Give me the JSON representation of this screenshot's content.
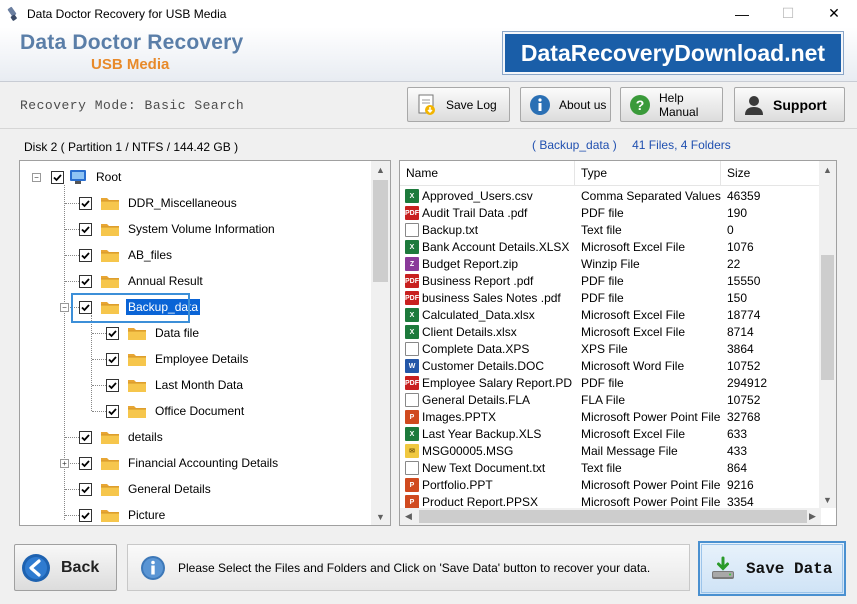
{
  "window": {
    "title": "Data Doctor Recovery for USB Media",
    "minimize": "—",
    "maximize": "☐",
    "close": "✕"
  },
  "header": {
    "brand_title": "Data Doctor Recovery",
    "brand_subtitle": "USB Media",
    "site_badge": "DataRecoveryDownload.net"
  },
  "toolbar": {
    "mode_label": "Recovery Mode: Basic Search",
    "save_log": "Save Log",
    "about_us": "About us",
    "help_manual": "Help Manual",
    "support": "Support"
  },
  "disk_label": "Disk 2 ( Partition 1 / NTFS / 144.42 GB )",
  "folder_info": {
    "folder": "( Backup_data )",
    "counts": "41 Files, 4 Folders"
  },
  "tree": {
    "root": "Root",
    "items": [
      {
        "label": "DDR_Miscellaneous",
        "level": 1,
        "checked": true,
        "expander": ""
      },
      {
        "label": "System Volume Information",
        "level": 1,
        "checked": true,
        "expander": ""
      },
      {
        "label": "AB_files",
        "level": 1,
        "checked": true,
        "expander": ""
      },
      {
        "label": "Annual Result",
        "level": 1,
        "checked": true,
        "expander": ""
      },
      {
        "label": "Backup_data",
        "level": 1,
        "checked": true,
        "expander": "−",
        "selected": true
      },
      {
        "label": "Data file",
        "level": 2,
        "checked": true,
        "expander": ""
      },
      {
        "label": "Employee Details",
        "level": 2,
        "checked": true,
        "expander": ""
      },
      {
        "label": "Last Month Data",
        "level": 2,
        "checked": true,
        "expander": ""
      },
      {
        "label": "Office Document",
        "level": 2,
        "checked": true,
        "expander": ""
      },
      {
        "label": "details",
        "level": 1,
        "checked": true,
        "expander": ""
      },
      {
        "label": "Financial Accounting Details",
        "level": 1,
        "checked": true,
        "expander": "+"
      },
      {
        "label": "General Details",
        "level": 1,
        "checked": true,
        "expander": ""
      },
      {
        "label": "Picture",
        "level": 1,
        "checked": true,
        "expander": ""
      }
    ]
  },
  "filelist": {
    "columns": [
      "Name",
      "Type",
      "Size"
    ],
    "rows": [
      {
        "name": "Approved_Users.csv",
        "type": "Comma Separated Values...",
        "size": "46359",
        "icon": "excel-icon"
      },
      {
        "name": "Audit Trail Data .pdf",
        "type": "PDF file",
        "size": "190",
        "icon": "pdf-icon"
      },
      {
        "name": "Backup.txt",
        "type": "Text file",
        "size": "0",
        "icon": "text-file-icon"
      },
      {
        "name": "Bank Account Details.XLSX",
        "type": "Microsoft Excel File",
        "size": "1076",
        "icon": "excel-icon"
      },
      {
        "name": "Budget Report.zip",
        "type": "Winzip File",
        "size": "22",
        "icon": "zip-icon"
      },
      {
        "name": "Business Report .pdf",
        "type": "PDF file",
        "size": "15550",
        "icon": "pdf-icon"
      },
      {
        "name": "business Sales Notes .pdf",
        "type": "PDF file",
        "size": "150",
        "icon": "pdf-icon"
      },
      {
        "name": "Calculated_Data.xlsx",
        "type": "Microsoft Excel File",
        "size": "18774",
        "icon": "excel-icon"
      },
      {
        "name": "Client Details.xlsx",
        "type": "Microsoft Excel File",
        "size": "8714",
        "icon": "excel-icon"
      },
      {
        "name": "Complete Data.XPS",
        "type": "XPS File",
        "size": "3864",
        "icon": "xps-icon"
      },
      {
        "name": "Customer Details.DOC",
        "type": "Microsoft Word File",
        "size": "10752",
        "icon": "word-icon"
      },
      {
        "name": "Employee Salary Report.PDF",
        "type": "PDF file",
        "size": "294912",
        "icon": "pdf-icon"
      },
      {
        "name": "General Details.FLA",
        "type": "FLA File",
        "size": "10752",
        "icon": "generic-file-icon"
      },
      {
        "name": "Images.PPTX",
        "type": "Microsoft Power Point File",
        "size": "32768",
        "icon": "powerpoint-icon"
      },
      {
        "name": "Last Year Backup.XLS",
        "type": "Microsoft Excel File",
        "size": "633",
        "icon": "excel-icon"
      },
      {
        "name": "MSG00005.MSG",
        "type": "Mail Message File",
        "size": "433",
        "icon": "mail-icon"
      },
      {
        "name": "New Text Document.txt",
        "type": "Text file",
        "size": "864",
        "icon": "text-file-icon"
      },
      {
        "name": "Portfolio.PPT",
        "type": "Microsoft Power Point File",
        "size": "9216",
        "icon": "powerpoint-icon"
      },
      {
        "name": "Product Report.PPSX",
        "type": "Microsoft Power Point File",
        "size": "3354",
        "icon": "powerpoint-icon"
      }
    ]
  },
  "bottom": {
    "back": "Back",
    "status_text": "Please Select the Files and Folders and Click on 'Save Data' button to recover your data.",
    "save_data": "Save Data"
  },
  "colors": {
    "brand_blue": "#5a7ea8",
    "brand_orange": "#e88a2a",
    "badge_blue": "#1a5ea8",
    "selection": "#0a64d6",
    "info_link": "#2050b0"
  }
}
